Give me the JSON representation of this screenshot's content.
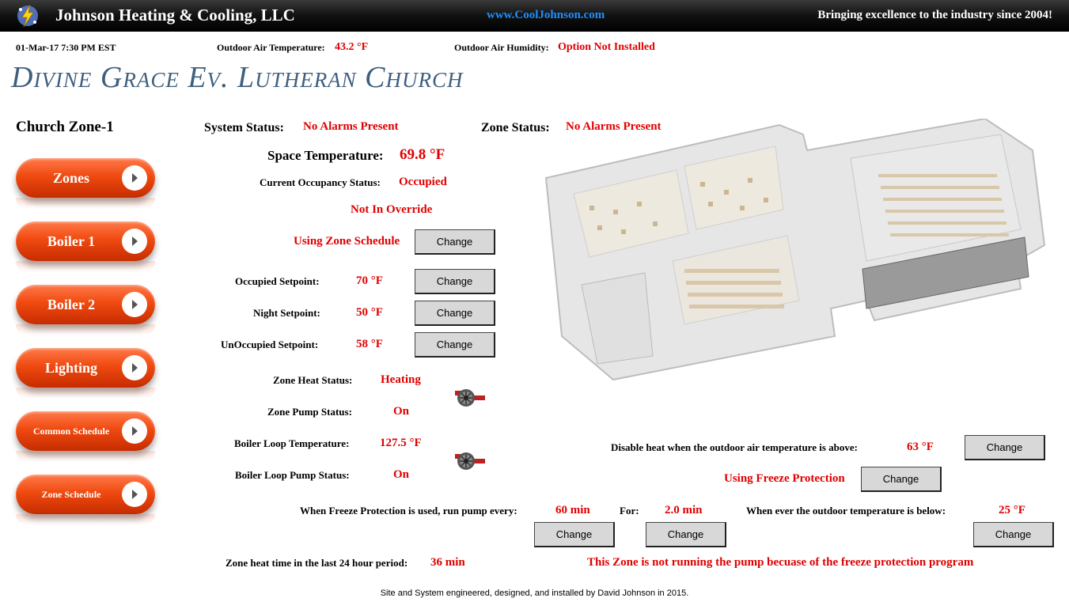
{
  "header": {
    "company": "Johnson Heating & Cooling, LLC",
    "website": "www.CoolJohnson.com",
    "slogan": "Bringing excellence to the industry since 2004!"
  },
  "infobar": {
    "datetime": "01-Mar-17 7:30 PM EST",
    "oat_label": "Outdoor Air Temperature:",
    "oat_value": "43.2 °F",
    "oah_label": "Outdoor Air Humidity:",
    "oah_value": "Option Not Installed"
  },
  "church_name": "Divine Grace Ev. Lutheran Church",
  "zone_title": "Church Zone-1",
  "nav": [
    {
      "label": "Zones"
    },
    {
      "label": "Boiler 1"
    },
    {
      "label": "Boiler 2"
    },
    {
      "label": "Lighting"
    },
    {
      "label": "Common Schedule"
    },
    {
      "label": "Zone Schedule"
    }
  ],
  "status": {
    "system_label": "System Status:",
    "system_value": "No Alarms Present",
    "zone_label": "Zone Status:",
    "zone_value": "No Alarms Present",
    "space_temp_label": "Space Temperature:",
    "space_temp_value": "69.8 °F",
    "occupancy_label": "Current Occupancy Status:",
    "occupancy_value": "Occupied",
    "override": "Not In Override",
    "schedule": "Using Zone Schedule"
  },
  "setpoints": {
    "occupied_label": "Occupied Setpoint:",
    "occupied_value": "70 °F",
    "night_label": "Night Setpoint:",
    "night_value": "50 °F",
    "unoccupied_label": "UnOccupied Setpoint:",
    "unoccupied_value": "58 °F"
  },
  "zone": {
    "heat_label": "Zone Heat Status:",
    "heat_value": "Heating",
    "pump_label": "Zone Pump Status:",
    "pump_value": "On",
    "loop_temp_label": "Boiler Loop Temperature:",
    "loop_temp_value": "127.5 °F",
    "loop_pump_label": "Boiler Loop Pump Status:",
    "loop_pump_value": "On"
  },
  "freeze": {
    "disable_label": "Disable heat when the outdoor air temperature is above:",
    "disable_value": "63 °F",
    "using": "Using Freeze Protection",
    "run_label": "When Freeze Protection is used, run pump every:",
    "run_value": "60 min",
    "for_label": "For:",
    "for_value": "2.0 min",
    "below_label": "When ever the outdoor temperature is below:",
    "below_value": "25 °F"
  },
  "heat_time_label": "Zone heat time in the last 24 hour period:",
  "heat_time_value": "36 min",
  "freeze_message": "This Zone is not running the pump becuase of the freeze protection program",
  "change_label": "Change",
  "footer": "Site and System engineered, designed, and installed by David Johnson in 2015.",
  "colors": {
    "header_bg": "#000000",
    "accent_red": "#e00000",
    "link_blue": "#1e90ff",
    "church_title": "#3f5f7f",
    "nav_button": "#f04a10"
  }
}
